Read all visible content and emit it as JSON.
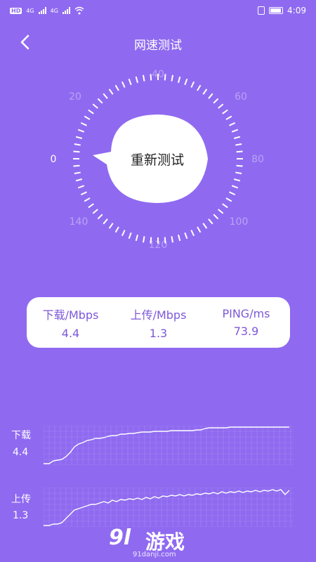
{
  "status_bar": {
    "left_badge": "HD",
    "network_1": "4G",
    "network_2": "4G",
    "time": "4:09"
  },
  "header": {
    "title": "网速测试"
  },
  "dial": {
    "button_label": "重新测试",
    "tick_labels": [
      "0",
      "20",
      "40",
      "60",
      "80",
      "100",
      "120",
      "140"
    ]
  },
  "stats": [
    {
      "label": "下载/Mbps",
      "value": "4.4"
    },
    {
      "label": "上传/Mbps",
      "value": "1.3"
    },
    {
      "label": "PING/ms",
      "value": "73.9"
    }
  ],
  "graphs": {
    "download": {
      "label": "下载",
      "value": "4.4"
    },
    "upload": {
      "label": "上传",
      "value": "1.3"
    }
  },
  "watermark": {
    "brand_number": "9l",
    "brand_cn": "游戏",
    "url": "91danji.com"
  },
  "colors": {
    "background": "#8f6af0",
    "accent_text": "#7d58d8",
    "white": "#ffffff"
  }
}
